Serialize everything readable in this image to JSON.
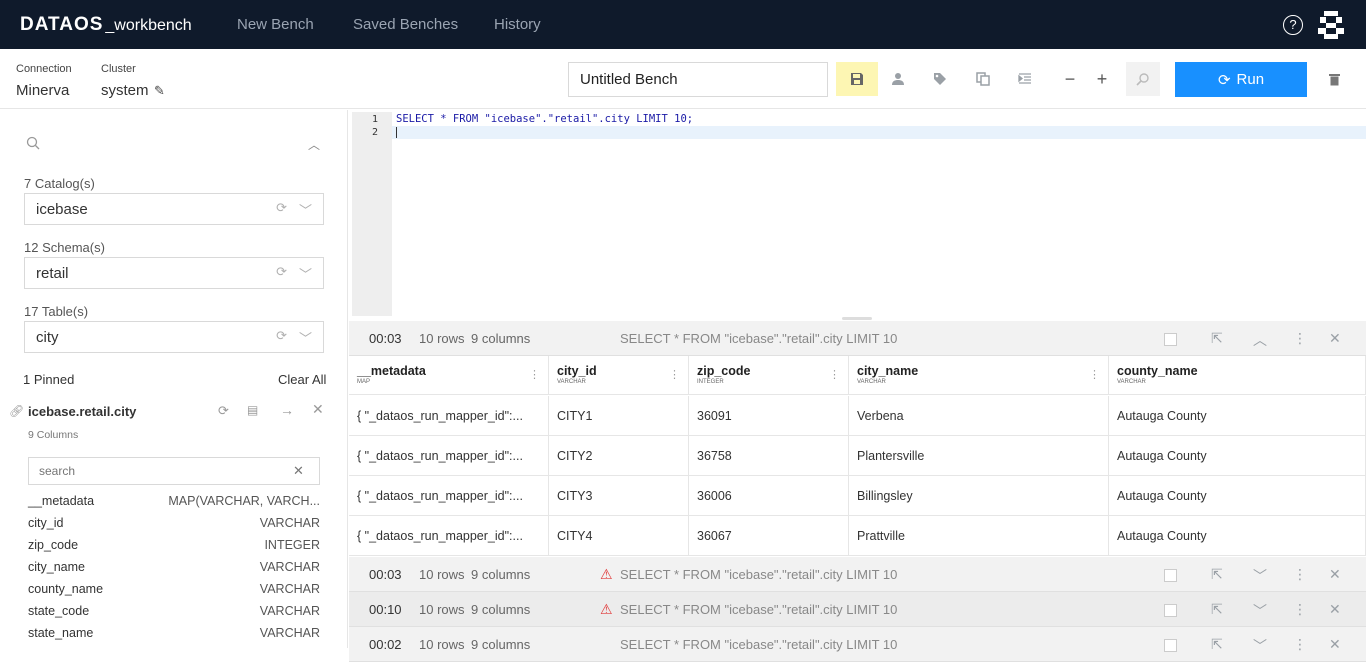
{
  "nav": {
    "brand": "DATAOS",
    "brand_sub": "_workbench",
    "links": [
      "New Bench",
      "Saved Benches",
      "History"
    ],
    "help_icon": "?"
  },
  "toolbar": {
    "connection_label": "Connection",
    "connection_value": "Minerva",
    "cluster_label": "Cluster",
    "cluster_value": "system",
    "bench_title": "Untitled Bench",
    "run_label": "Run"
  },
  "sidebar": {
    "catalog_label": "7 Catalog(s)",
    "catalog_value": "icebase",
    "schema_label": "12 Schema(s)",
    "schema_value": "retail",
    "table_label": "17 Table(s)",
    "table_value": "city",
    "pinned_label": "1 Pinned",
    "clear_all": "Clear All",
    "pinned_table": "icebase.retail.city",
    "pinned_columns_count": "9 Columns",
    "column_search_placeholder": "search",
    "columns": [
      {
        "name": "__metadata",
        "type": "MAP(VARCHAR, VARCH..."
      },
      {
        "name": "city_id",
        "type": "VARCHAR"
      },
      {
        "name": "zip_code",
        "type": "INTEGER"
      },
      {
        "name": "city_name",
        "type": "VARCHAR"
      },
      {
        "name": "county_name",
        "type": "VARCHAR"
      },
      {
        "name": "state_code",
        "type": "VARCHAR"
      },
      {
        "name": "state_name",
        "type": "VARCHAR"
      }
    ]
  },
  "editor": {
    "line_numbers": [
      "1",
      "2"
    ],
    "lines": [
      "SELECT * FROM \"icebase\".\"retail\".city LIMIT 10;",
      ""
    ]
  },
  "results": [
    {
      "time": "00:03",
      "rows": "10 rows",
      "cols": "9 columns",
      "query": "SELECT * FROM \"icebase\".\"retail\".city LIMIT 10",
      "warning": false,
      "expanded": true
    },
    {
      "time": "00:03",
      "rows": "10 rows",
      "cols": "9 columns",
      "query": "SELECT * FROM \"icebase\".\"retail\".city LIMIT 10",
      "warning": true,
      "expanded": false
    },
    {
      "time": "00:10",
      "rows": "10 rows",
      "cols": "9 columns",
      "query": "SELECT * FROM \"icebase\".\"retail\".city LIMIT 10",
      "warning": true,
      "expanded": false
    },
    {
      "time": "00:02",
      "rows": "10 rows",
      "cols": "9 columns",
      "query": "SELECT * FROM \"icebase\".\"retail\".city LIMIT 10",
      "warning": false,
      "expanded": false
    }
  ],
  "grid": {
    "columns": [
      {
        "name": "__metadata",
        "type": "MAP"
      },
      {
        "name": "city_id",
        "type": "VARCHAR"
      },
      {
        "name": "zip_code",
        "type": "INTEGER"
      },
      {
        "name": "city_name",
        "type": "VARCHAR"
      },
      {
        "name": "county_name",
        "type": "VARCHAR"
      }
    ],
    "rows": [
      [
        "{ \"_dataos_run_mapper_id\":...",
        "CITY1",
        "36091",
        "Verbena",
        "Autauga County"
      ],
      [
        "{ \"_dataos_run_mapper_id\":...",
        "CITY2",
        "36758",
        "Plantersville",
        "Autauga County"
      ],
      [
        "{ \"_dataos_run_mapper_id\":...",
        "CITY3",
        "36006",
        "Billingsley",
        "Autauga County"
      ],
      [
        "{ \"_dataos_run_mapper_id\":...",
        "CITY4",
        "36067",
        "Prattville",
        "Autauga County"
      ]
    ]
  },
  "colors": {
    "accent": "#1890ff",
    "topbar": "#0f1a2b",
    "save_highlight": "#fdf6b3",
    "warning": "#e03a3a"
  }
}
